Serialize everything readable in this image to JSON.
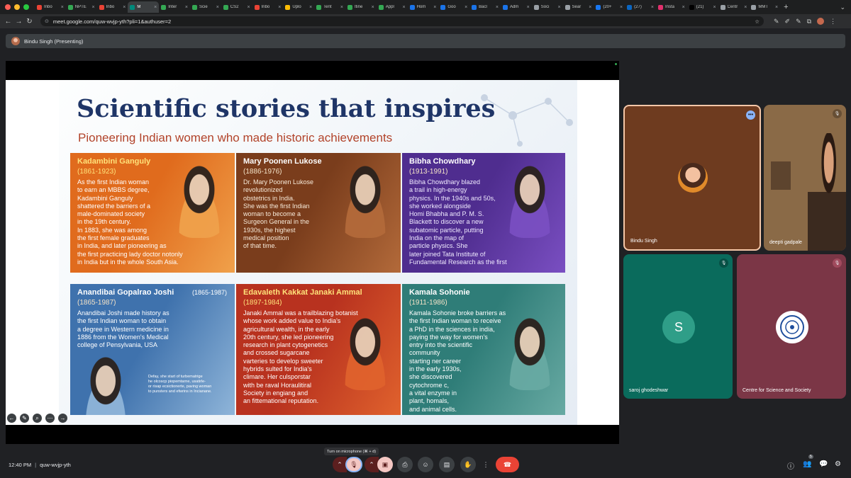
{
  "tabs": [
    {
      "label": "Inbo",
      "color": "#ea4335",
      "active": false
    },
    {
      "label": "NPTE",
      "color": "#34a853",
      "active": false
    },
    {
      "label": "Inbo",
      "color": "#ea4335",
      "active": false
    },
    {
      "label": "M",
      "color": "#00897b",
      "active": true
    },
    {
      "label": "Inter",
      "color": "#34a853",
      "active": false
    },
    {
      "label": "Scie",
      "color": "#34a853",
      "active": false
    },
    {
      "label": "CS2",
      "color": "#34a853",
      "active": false
    },
    {
      "label": "Inbo",
      "color": "#ea4335",
      "active": false
    },
    {
      "label": "Uplo",
      "color": "#fbbc04",
      "active": false
    },
    {
      "label": "Tent",
      "color": "#34a853",
      "active": false
    },
    {
      "label": "Itine",
      "color": "#34a853",
      "active": false
    },
    {
      "label": "Appl",
      "color": "#34a853",
      "active": false
    },
    {
      "label": "Hom",
      "color": "#1a73e8",
      "active": false
    },
    {
      "label": "Goo",
      "color": "#1a73e8",
      "active": false
    },
    {
      "label": "Bacl",
      "color": "#1a73e8",
      "active": false
    },
    {
      "label": "Adm",
      "color": "#1a73e8",
      "active": false
    },
    {
      "label": "Soci",
      "color": "#9aa0a6",
      "active": false
    },
    {
      "label": "Sear",
      "color": "#9aa0a6",
      "active": false
    },
    {
      "label": "(20+",
      "color": "#1877f2",
      "active": false
    },
    {
      "label": "(27)",
      "color": "#0a66c2",
      "active": false
    },
    {
      "label": "Insta",
      "color": "#e1306c",
      "active": false
    },
    {
      "label": "(21)",
      "color": "#000000",
      "active": false
    },
    {
      "label": "Centr",
      "color": "#9aa0a6",
      "active": false
    },
    {
      "label": "MMT",
      "color": "#9aa0a6",
      "active": false
    }
  ],
  "address": {
    "url": "meet.google.com/quw-wvjp-yth?pli=1&authuser=2"
  },
  "presenting": {
    "label": "Bindu Singh (Presenting)"
  },
  "slide": {
    "title": "Scientific stories that inspires",
    "subtitle": "Pioneering Indian women who made historic achievements",
    "cards": [
      {
        "name": "Kadambini Ganguly",
        "years": "(1861-1923)",
        "body": "As the first Indian woman\nto earn an MBBS degree,\nKadambini Ganguly\nshattered the barriers of a\nmale-dominated society\nin the 19th century.\nIn 1883, she was among\nthe first female graduates\nin India, and later pioneering as\nthe first practicing lady doctor notonly\nin India but in the whole South Asia.",
        "bg": "#e06b1d",
        "bg2": "#f0a14b",
        "nameColor": "#ffe27a",
        "textColor": "#ffffff"
      },
      {
        "name": "Mary Poonen Lukose",
        "years": "(1886-1976)",
        "body": "Dr. Mary Poonen Lukose\nrevolutionized\nobstetrics in India.\nShe was the first Indian\nwoman to become a\nSurgeon General in the\n1930s, the highest\nmedical position\nof that time.",
        "bg": "#7a3d1c",
        "bg2": "#b36a3a",
        "nameColor": "#ffffff",
        "textColor": "#f7ead9"
      },
      {
        "name": "Bibha Chowdhary",
        "years": "(1913-1991)",
        "body": "Bibha Chowdhary blazed\na trail in high-energy\nphysics. In the 1940s and 50s,\nshe worked alongside\nHomi Bhabha and P. M. S.\nBlackett to discover a new\nsubatomic particle, putting\nIndia on the map of\nparticle physics. She\nlater joined Tata Institute of\nFundamental Research as the first",
        "bg": "#4f2d8f",
        "bg2": "#7a4fc2",
        "nameColor": "#ffffff",
        "textColor": "#f0eaff"
      },
      {
        "name": "Anandibai Gopalrao Joshi",
        "nameExtra": "(1865-1987)",
        "years": "(1865-1987)",
        "body": "Anandibai Joshi made history as\nthe first Indian woman to obtain\na degree in Western medicine in\n1886 from the Women's Medical\ncollege of Pensylvania, USA",
        "bg": "#3f72ad",
        "bg2": "#8fb5d9",
        "nameColor": "#ffffff",
        "textColor": "#ffffff"
      },
      {
        "name": "Edavaleth Kakkat Janaki Ammal",
        "years": "(1897-1984)",
        "body": "Janaki Ammal was a trailblazing botanist\nwhose work added value to India's\nagricultural wealth, in the early\n20th century, she led pioneering\nresearch in plant cytogenetics\nand crossed sugarcane\nvarteries to develop sweeter\nhybrids sulted for India's\nclimare. Her culsporstar\nwith be raval Horaulitiral\nSociety in engiang and\nan fittemational reputation.",
        "bg": "#b8321f",
        "bg2": "#e0622d",
        "nameColor": "#ffe27a",
        "textColor": "#ffffff"
      },
      {
        "name": "Kamala Sohonie",
        "years": "(1911-1986)",
        "body": "Kamala Sohonie broke barriers as\nthe first Indian woman to receive\na PhD in the sciences in india,\npaying the way for women's\nentry into the scientific\ncommunity\nstarting ner career\nin the early 1930s,\nshe discovered\ncytochrome c,\na vital enzyme in\nplant, homals,\nand animal cells.",
        "bg": "#2f7d78",
        "bg2": "#68aaa3",
        "nameColor": "#ffffff",
        "textColor": "#ffffff"
      }
    ],
    "caption": "Defay, she start of turbematrige\nhe olcoscp piopemtarne, usatirle-\nor risap ecsictionerte, paving woman\nto punsters and efwrins in Incianane."
  },
  "participants": [
    {
      "name": "Bindu Singh",
      "color": "#6e3b1f",
      "kind": "photo"
    },
    {
      "name": "deepti gadpale",
      "color": "#8a6a47",
      "kind": "video"
    },
    {
      "name": "saroj ghodeshwar",
      "color": "#0a6b5c",
      "kind": "letter",
      "letter": "S"
    },
    {
      "name": "Centre for Science and Society",
      "color": "#7b3646",
      "kind": "logo"
    }
  ],
  "bottom": {
    "time": "12:40 PM",
    "meeting_code": "quw-wvjp-yth",
    "mic_tooltip": "Turn on microphone (⌘ + d)",
    "people_count": "5"
  }
}
